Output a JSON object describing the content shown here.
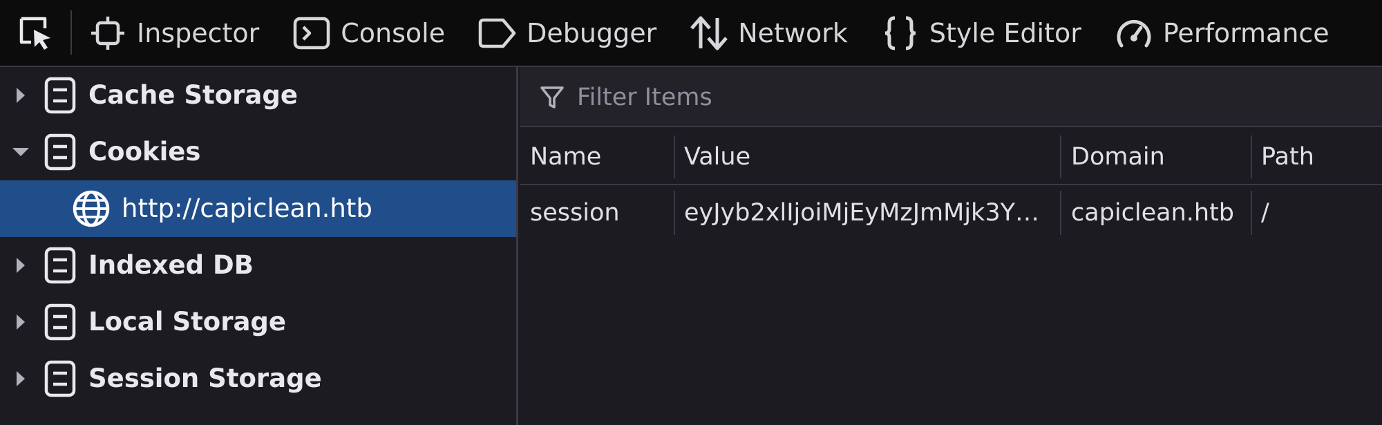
{
  "toolbar": {
    "tabs": [
      {
        "label": "Inspector",
        "icon": "inspector-icon"
      },
      {
        "label": "Console",
        "icon": "console-icon"
      },
      {
        "label": "Debugger",
        "icon": "debugger-icon"
      },
      {
        "label": "Network",
        "icon": "network-icon"
      },
      {
        "label": "Style Editor",
        "icon": "style-editor-icon"
      },
      {
        "label": "Performance",
        "icon": "performance-icon"
      }
    ]
  },
  "sidebar": {
    "items": [
      {
        "label": "Cache Storage",
        "expanded": false,
        "icon": "storage-icon"
      },
      {
        "label": "Cookies",
        "expanded": true,
        "icon": "storage-icon",
        "children": [
          {
            "label": "http://capiclean.htb",
            "icon": "globe-icon",
            "selected": true
          }
        ]
      },
      {
        "label": "Indexed DB",
        "expanded": false,
        "icon": "storage-icon"
      },
      {
        "label": "Local Storage",
        "expanded": false,
        "icon": "storage-icon"
      },
      {
        "label": "Session Storage",
        "expanded": false,
        "icon": "storage-icon"
      }
    ]
  },
  "main": {
    "filter": {
      "placeholder": "Filter Items",
      "value": ""
    },
    "columns": [
      "Name",
      "Value",
      "Domain",
      "Path"
    ],
    "rows": [
      {
        "name": "session",
        "value": "eyJyb2xlIjoiMjEyMzJmMjk3Y…",
        "domain": "capiclean.htb",
        "path": "/"
      }
    ]
  },
  "colors": {
    "toolbar_bg": "#0c0c0d",
    "panel_bg": "#1c1b22",
    "selected_bg": "#204e8a",
    "border": "#3a3944"
  }
}
